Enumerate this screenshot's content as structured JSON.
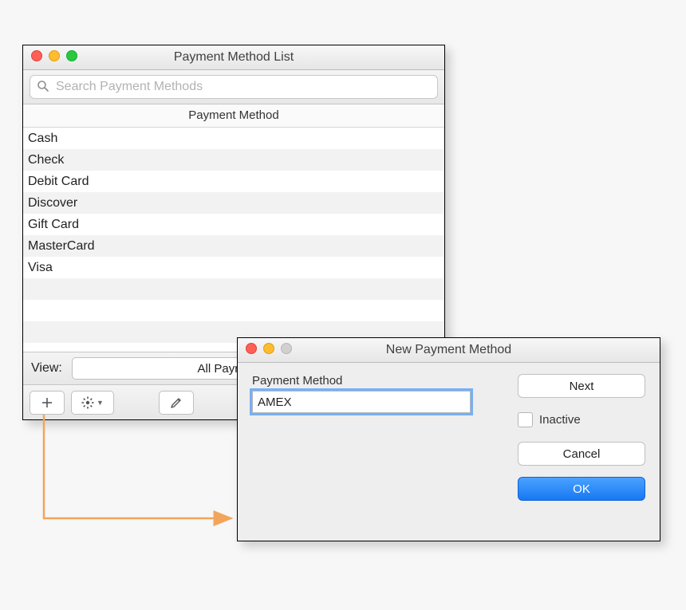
{
  "list_window": {
    "title": "Payment Method List",
    "search_placeholder": "Search Payment Methods",
    "column_header": "Payment Method",
    "rows": [
      "Cash",
      "Check",
      "Debit Card",
      "Discover",
      "Gift Card",
      "MasterCard",
      "Visa"
    ],
    "view_label": "View:",
    "view_value": "All Payment Methods",
    "icons": {
      "search": "search-icon",
      "add": "plus-icon",
      "gear": "gear-icon",
      "edit": "pencil-icon"
    }
  },
  "new_window": {
    "title": "New Payment Method",
    "field_label": "Payment Method",
    "field_value": "AMEX",
    "inactive_label": "Inactive",
    "next_label": "Next",
    "cancel_label": "Cancel",
    "ok_label": "OK"
  },
  "colors": {
    "primary_button": "#1b7df3",
    "focus_ring": "#57a0f7",
    "callout_arrow": "#f2a55a"
  }
}
